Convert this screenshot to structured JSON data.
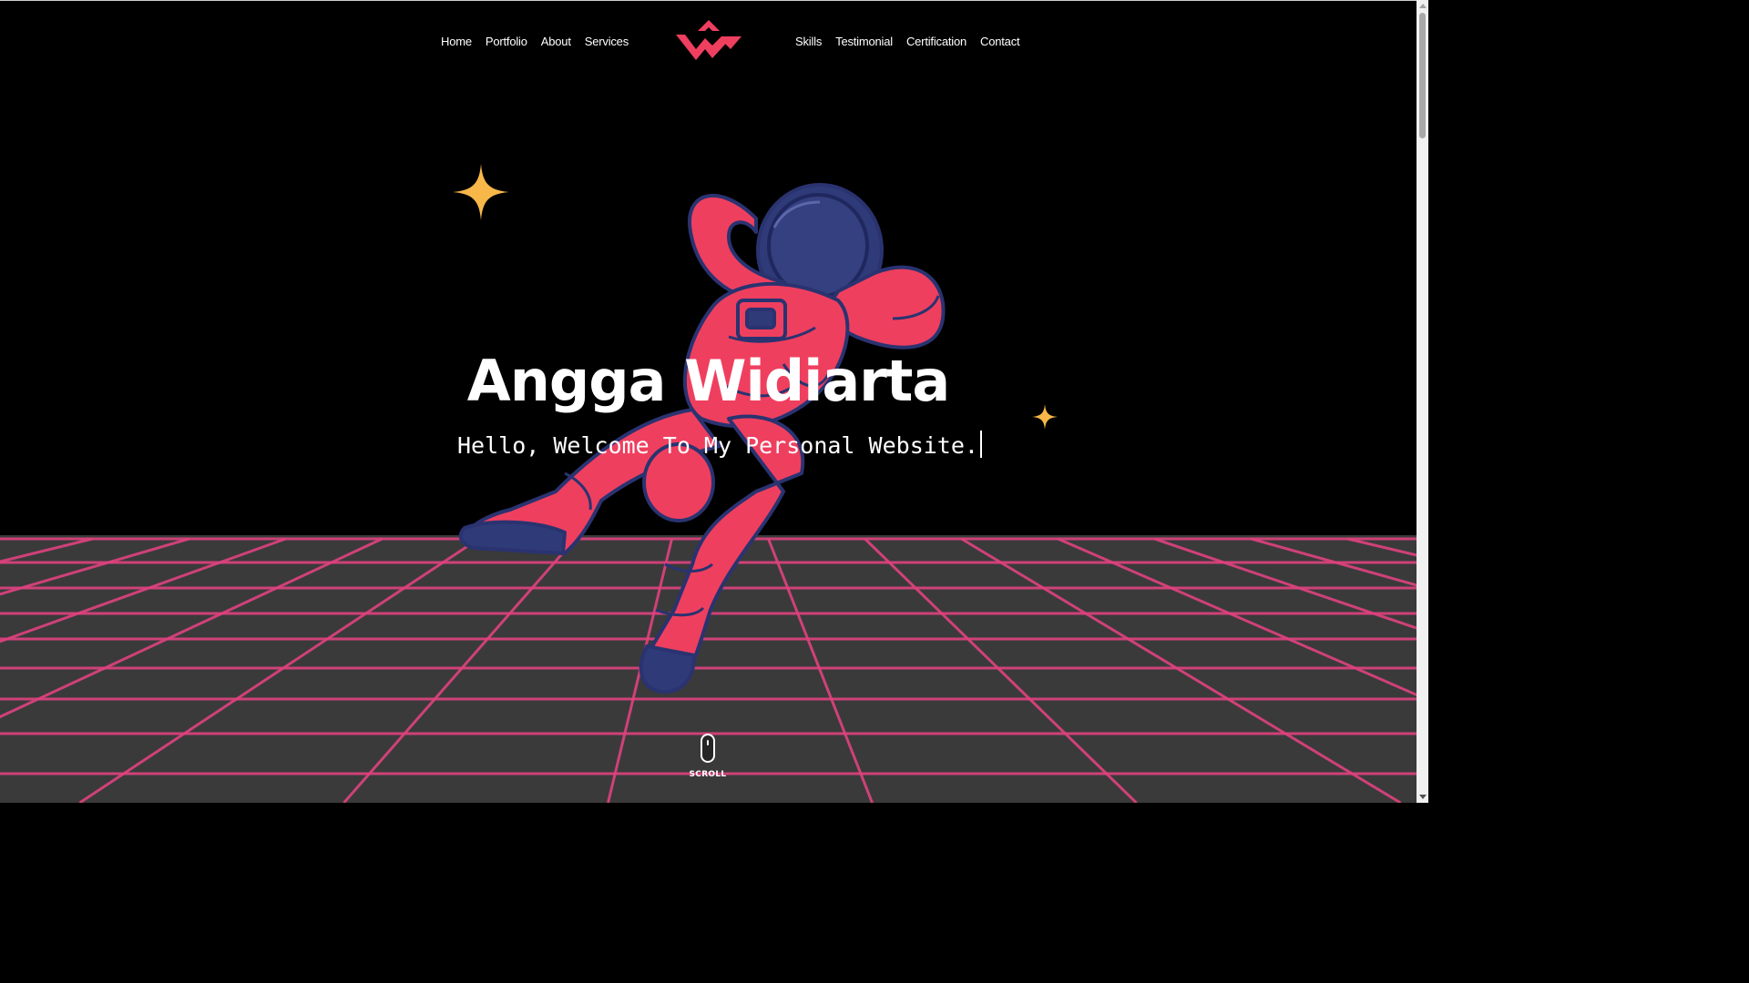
{
  "nav": {
    "left_links": [
      {
        "label": "Home"
      },
      {
        "label": "Portfolio"
      },
      {
        "label": "About"
      },
      {
        "label": "Services"
      }
    ],
    "right_links": [
      {
        "label": "Skills"
      },
      {
        "label": "Testimonial"
      },
      {
        "label": "Certification"
      },
      {
        "label": "Contact"
      }
    ],
    "logo_icon": "aw-chevron-logo-icon"
  },
  "hero": {
    "title": "Angga Widiarta",
    "subtitle": "Hello, Welcome To My Personal Website.",
    "illustration": "floating-astronaut-icon"
  },
  "scroll": {
    "label": "SCROLL",
    "icon": "mouse-icon"
  },
  "colors": {
    "background": "#000000",
    "accent": "#ef3f5f",
    "astronaut_navy": "#2f3a78",
    "star": "#f7b849",
    "grid_line": "#e0427f",
    "grid_fill": "#3a3a3a"
  }
}
